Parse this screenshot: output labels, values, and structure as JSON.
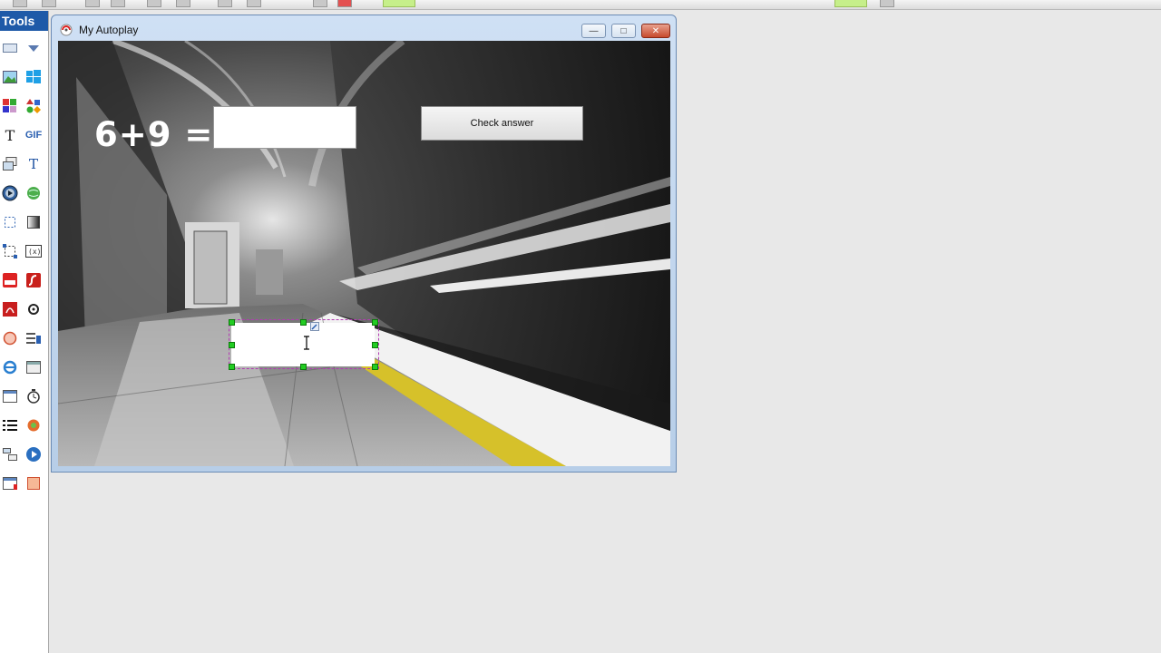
{
  "tools_panel": {
    "title": "Tools",
    "icons": [
      "rectangle-icon",
      "dropdown-icon",
      "image-icon",
      "windows-icon",
      "mosaic-icon",
      "shapes-icon",
      "text-icon",
      "gif-icon",
      "layers-icon",
      "fancy-text-icon",
      "media-player-icon",
      "web-icon",
      "crop-icon",
      "gradient-icon",
      "bounds-icon",
      "variable-icon",
      "youtube-icon",
      "flash-icon",
      "pdf-icon",
      "spiral-icon",
      "circle-icon",
      "list-edit-icon",
      "ie-icon",
      "panel-icon",
      "input-icon",
      "timer-icon",
      "list-icon",
      "plugin-icon",
      "tree-icon",
      "play-icon",
      "window-icon",
      "slideshow-icon"
    ]
  },
  "window": {
    "title": "My Autoplay"
  },
  "page": {
    "equation": "6+9 =",
    "check_button_label": "Check answer"
  },
  "colors": {
    "tools_header": "#1e5aa8",
    "handle": "#22cc22",
    "close_button": "#c74a2d"
  }
}
